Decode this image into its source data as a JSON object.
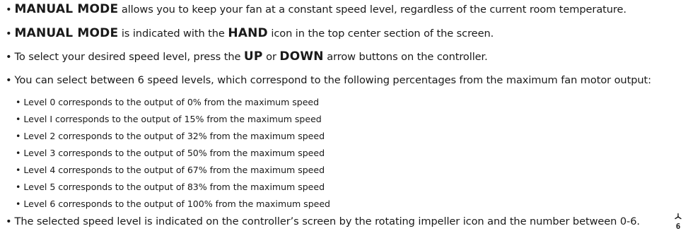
{
  "bullet": "•",
  "intro": {
    "mode_text": "MANUAL MODE",
    "rest": " allows you to keep your fan at a constant speed level, regardless of the current room temperature."
  },
  "indicator": {
    "mode_text": "MANUAL MODE",
    "middle": " is indicated with the ",
    "hand": "HAND",
    "rest": " icon in the top center section of the screen."
  },
  "select": {
    "prefix": "To select your desired speed level, press the ",
    "up": "UP",
    "or": " or ",
    "down": "DOWN",
    "rest": " arrow buttons on the controller."
  },
  "levels_intro": "You can select between 6 speed levels, which correspond to the following percentages from the maximum fan motor output:",
  "levels": [
    "Level 0 corresponds to the output of 0% from the maximum speed",
    "Level I corresponds to the output of 15% from the maximum speed",
    "Level 2 corresponds to the output of 32% from the maximum speed",
    "Level 3 corresponds to the output of 50% from the maximum speed",
    "Level 4 corresponds to the output of 67% from the maximum speed",
    "Level 5 corresponds to the output of 83% from the maximum speed",
    "Level 6 corresponds to the output of 100% from the maximum speed"
  ],
  "closing": "The selected speed level is indicated on the controller’s screen by the rotating impeller icon and the number between 0-6.",
  "fan_icon": {
    "icon": "fan-impeller-icon",
    "digit": "6"
  }
}
